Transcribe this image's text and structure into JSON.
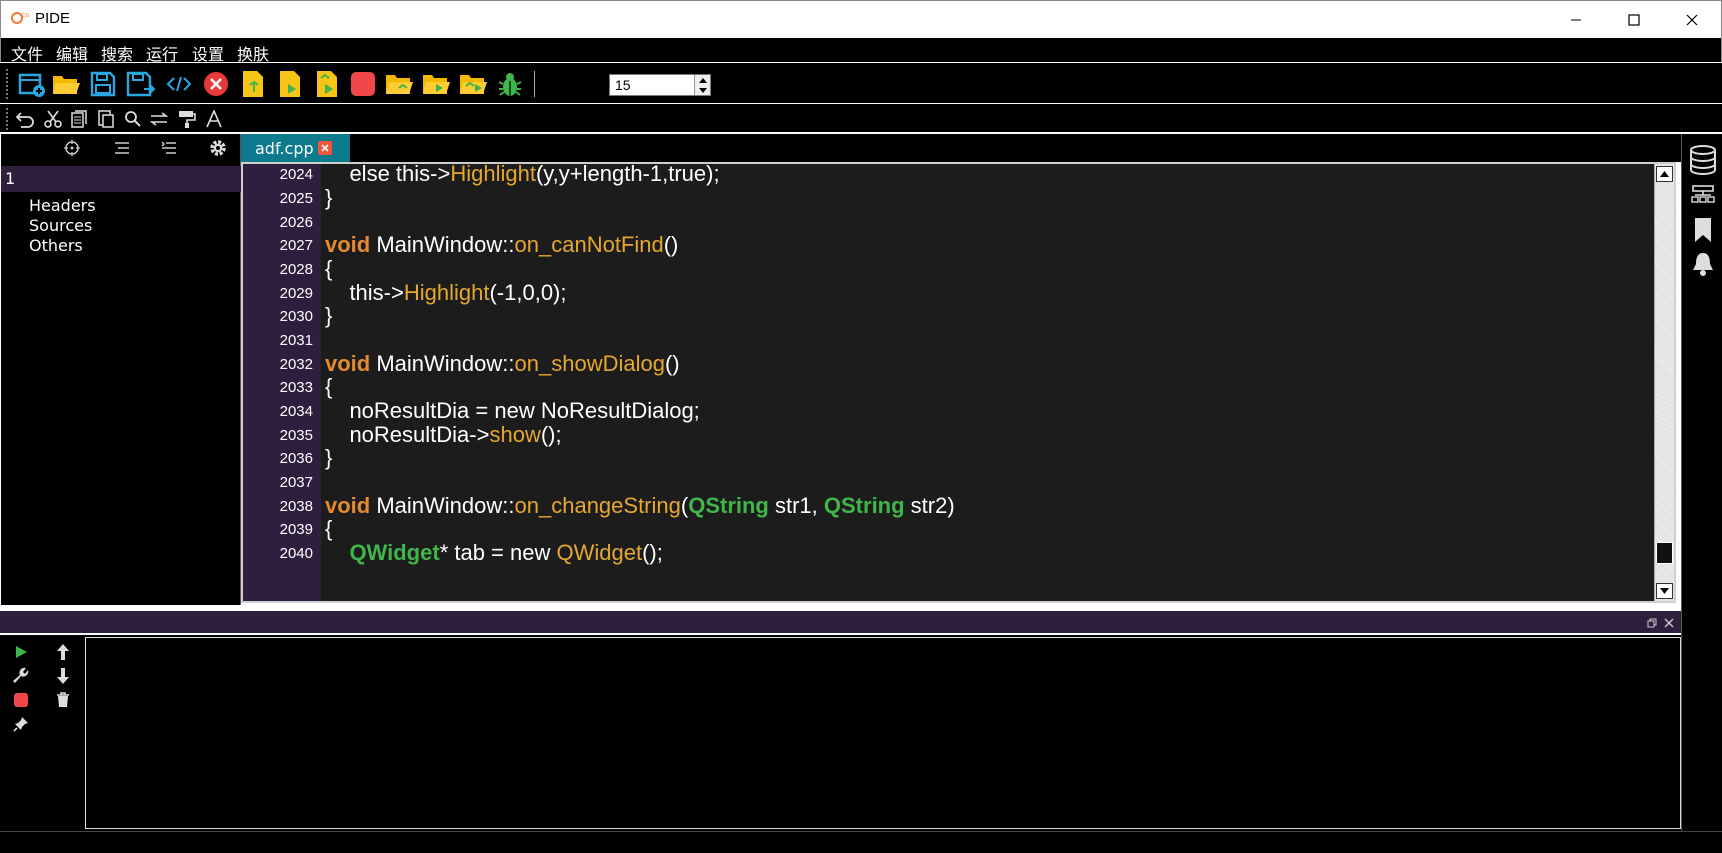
{
  "window": {
    "title": "PIDE"
  },
  "menu": [
    "文件",
    "编辑",
    "搜索",
    "运行",
    "设置",
    "换肤"
  ],
  "toolbar": {
    "font_size": "15"
  },
  "project_tree": {
    "root": "1",
    "items": [
      "Headers",
      "Sources",
      "Others"
    ]
  },
  "editor": {
    "tab_label": "adf.cpp",
    "lines": [
      {
        "n": "2024"
      },
      {
        "n": "2025"
      },
      {
        "n": "2026"
      },
      {
        "n": "2027"
      },
      {
        "n": "2028"
      },
      {
        "n": "2029"
      },
      {
        "n": "2030"
      },
      {
        "n": "2031"
      },
      {
        "n": "2032"
      },
      {
        "n": "2033"
      },
      {
        "n": "2034"
      },
      {
        "n": "2035"
      },
      {
        "n": "2036"
      },
      {
        "n": "2037"
      },
      {
        "n": "2038"
      },
      {
        "n": "2039"
      },
      {
        "n": "2040"
      }
    ],
    "code": {
      "l2024a": "    else this->",
      "l2024b": "Highlight",
      "l2024c": "(y,y+length-1,true);",
      "l2025": "}",
      "l2027a": "void",
      "l2027b": " MainWindow::",
      "l2027c": "on_canNotFind",
      "l2027d": "()",
      "l2028": "{",
      "l2029a": "    this->",
      "l2029b": "Highlight",
      "l2029c": "(-1,0,0);",
      "l2030": "}",
      "l2032a": "void",
      "l2032b": " MainWindow::",
      "l2032c": "on_showDialog",
      "l2032d": "()",
      "l2033": "{",
      "l2034": "    noResultDia = new NoResultDialog;",
      "l2035a": "    noResultDia->",
      "l2035b": "show",
      "l2035c": "();",
      "l2036": "}",
      "l2038a": "void",
      "l2038b": " MainWindow::",
      "l2038c": "on_changeString",
      "l2038d": "(",
      "l2038e": "QString",
      "l2038f": " str1, ",
      "l2038g": "QString",
      "l2038h": " str2)",
      "l2039": "{",
      "l2040a": "    QWidget",
      "l2040b": "* tab = new ",
      "l2040c": "QWidget",
      "l2040d": "();"
    }
  },
  "colors": {
    "keyword": "#e58a2e",
    "function": "#e5a82e",
    "type": "#3fb54a",
    "gutter": "#2d1f3d",
    "tab": "#0d7a8e"
  },
  "icons": {
    "toolbar": [
      "new-project-icon",
      "open-folder-icon",
      "save-icon",
      "save-as-icon",
      "code-icon",
      "close-icon",
      "compile-file-icon",
      "run-file-icon",
      "compile-run-icon",
      "stop-icon",
      "folder-compile-icon",
      "folder-run-icon",
      "folder-compile-run-icon",
      "debug-icon"
    ],
    "edit": [
      "undo-icon",
      "cut-icon",
      "copy-icon",
      "paste-icon",
      "search-icon",
      "replace-icon",
      "format-painter-icon",
      "font-icon"
    ],
    "right": [
      "database-icon",
      "structure-icon",
      "bookmark-icon",
      "bell-icon"
    ]
  }
}
